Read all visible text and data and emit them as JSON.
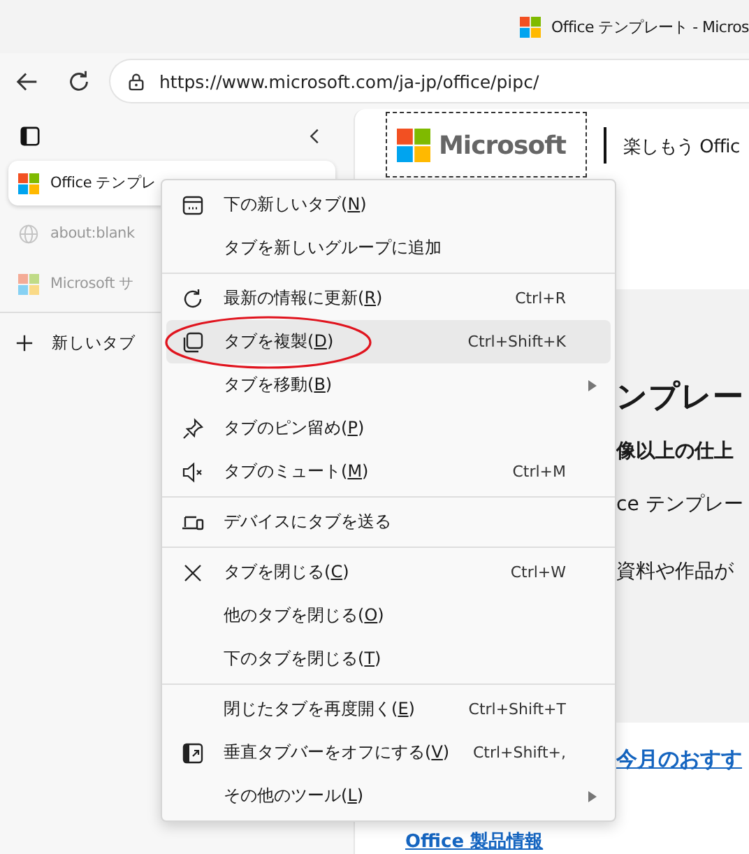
{
  "window": {
    "tab_title": "Office テンプレート - Micros"
  },
  "toolbar": {
    "url": "https://www.microsoft.com/ja-jp/office/pipc/"
  },
  "sidebar": {
    "tabs": [
      {
        "title": "Office テンプレ",
        "selected": true,
        "faded": false
      },
      {
        "title": "about:blank",
        "selected": false,
        "faded": true
      },
      {
        "title": "Microsoft サ",
        "selected": false,
        "faded": true
      }
    ],
    "new_tab": "新しいタブ"
  },
  "page": {
    "brand": "Microsoft",
    "tagline": "楽しもう Offic",
    "heading": "ンプレー",
    "subheading": "像以上の仕上",
    "line_1": "ce テンプレー",
    "line_2": "資料や作品が",
    "links": [
      "今月のおすす",
      "Office 製品情報"
    ]
  },
  "context_menu": {
    "items": [
      {
        "kind": "item",
        "label": [
          "下の新しいタブ(",
          "N",
          ")"
        ],
        "submenu": false,
        "highlighted": false,
        "circled": false
      },
      {
        "kind": "item",
        "label": [
          "タブを新しいグループに追加"
        ],
        "submenu": false,
        "highlighted": false,
        "circled": false
      },
      {
        "kind": "separator"
      },
      {
        "kind": "item",
        "label": [
          "最新の情報に更新(",
          "R",
          ")"
        ],
        "shortcut": "Ctrl+R",
        "submenu": false,
        "highlighted": false,
        "circled": false
      },
      {
        "kind": "item",
        "label": [
          "タブを複製(",
          "D",
          ")"
        ],
        "shortcut": "Ctrl+Shift+K",
        "submenu": false,
        "highlighted": true,
        "circled": true
      },
      {
        "kind": "item",
        "label": [
          "タブを移動(",
          "B",
          ")"
        ],
        "submenu": true,
        "highlighted": false,
        "circled": false
      },
      {
        "kind": "item",
        "label": [
          "タブのピン留め(",
          "P",
          ")"
        ],
        "submenu": false,
        "highlighted": false,
        "circled": false
      },
      {
        "kind": "item",
        "label": [
          "タブのミュート(",
          "M",
          ")"
        ],
        "shortcut": "Ctrl+M",
        "submenu": false,
        "highlighted": false,
        "circled": false
      },
      {
        "kind": "separator"
      },
      {
        "kind": "item",
        "label": [
          "デバイスにタブを送る"
        ],
        "submenu": false,
        "highlighted": false,
        "circled": false
      },
      {
        "kind": "separator"
      },
      {
        "kind": "item",
        "label": [
          "タブを閉じる(",
          "C",
          ")"
        ],
        "shortcut": "Ctrl+W",
        "submenu": false,
        "highlighted": false,
        "circled": false
      },
      {
        "kind": "item",
        "label": [
          "他のタブを閉じる(",
          "O",
          ")"
        ],
        "submenu": false,
        "highlighted": false,
        "circled": false
      },
      {
        "kind": "item",
        "label": [
          "下のタブを閉じる(",
          "T",
          ")"
        ],
        "submenu": false,
        "highlighted": false,
        "circled": false
      },
      {
        "kind": "separator"
      },
      {
        "kind": "item",
        "label": [
          "閉じたタブを再度開く(",
          "E",
          ")"
        ],
        "shortcut": "Ctrl+Shift+T",
        "submenu": false,
        "highlighted": false,
        "circled": false
      },
      {
        "kind": "item",
        "label": [
          "垂直タブバーをオフにする(",
          "V",
          ")"
        ],
        "shortcut": "Ctrl+Shift+,",
        "submenu": false,
        "highlighted": false,
        "circled": false
      },
      {
        "kind": "item",
        "label": [
          "その他のツール(",
          "L",
          ")"
        ],
        "submenu": true,
        "highlighted": false,
        "circled": false
      }
    ]
  }
}
